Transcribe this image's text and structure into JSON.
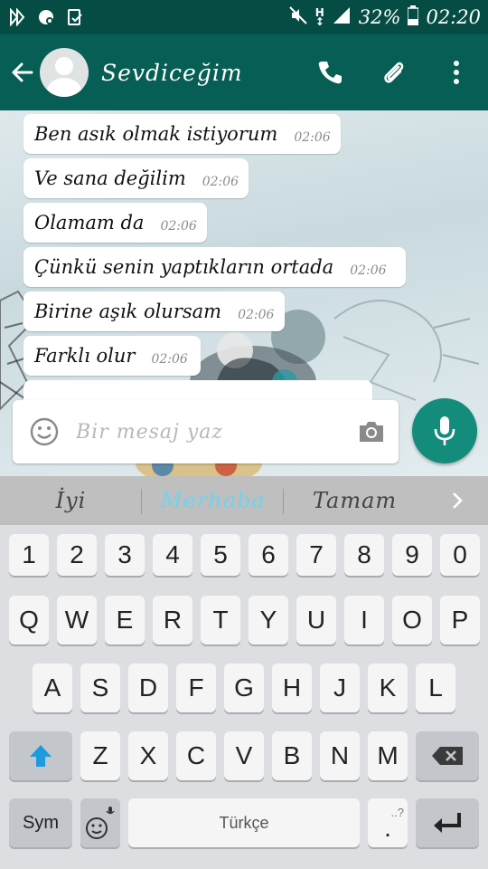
{
  "status": {
    "battery": "32%",
    "time": "02:20"
  },
  "header": {
    "contact_name": "Sevdiceğim"
  },
  "messages": [
    {
      "text": "Ben asık olmak istiyorum",
      "time": "02:06"
    },
    {
      "text": "Ve sana değilim",
      "time": "02:06"
    },
    {
      "text": "Olamam da",
      "time": "02:06"
    },
    {
      "text": "Çünkü senin yaptıkların ortada",
      "time": "02:06"
    },
    {
      "text": "Birine aşık olursam",
      "time": "02:06"
    },
    {
      "text": "Farklı olur",
      "time": "02:06"
    }
  ],
  "composer": {
    "placeholder": "Bir mesaj yaz"
  },
  "suggestions": [
    "İyi",
    "Merhaba",
    "Tamam"
  ],
  "keyboard": {
    "row_numbers": [
      "1",
      "2",
      "3",
      "4",
      "5",
      "6",
      "7",
      "8",
      "9",
      "0"
    ],
    "row_1": [
      "Q",
      "W",
      "E",
      "R",
      "T",
      "Y",
      "U",
      "I",
      "O",
      "P"
    ],
    "row_2": [
      "A",
      "S",
      "D",
      "F",
      "G",
      "H",
      "J",
      "K",
      "L"
    ],
    "row_3": [
      "Z",
      "X",
      "C",
      "V",
      "B",
      "N",
      "M"
    ],
    "sym_label": "Sym",
    "space_label": "Türkçe",
    "period_label": "."
  },
  "colors": {
    "app_bar": "#075e54",
    "status_bar": "#054d44",
    "mic_button": "#138c7b",
    "suggestion_highlight": "#6fd3f0"
  }
}
